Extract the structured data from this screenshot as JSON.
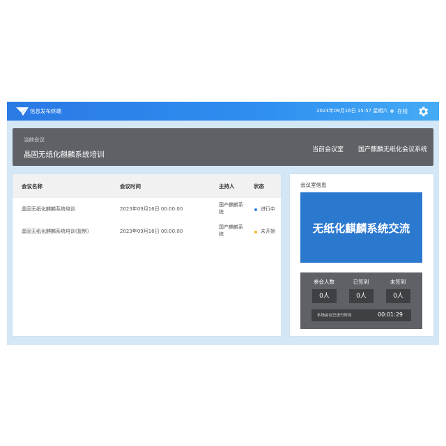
{
  "header": {
    "app_title": "信息发布终端",
    "datetime": "2023年09月16日 15:57 星期六",
    "status": "在线",
    "logo_icon": "paper-plane-logo",
    "settings_icon": "gear-icon",
    "colors": {
      "bar_start": "#2a79e4",
      "bar_end": "#45abf5"
    }
  },
  "banner": {
    "label": "当前会议",
    "meeting_name": "晶固无纸化麒麟系统培训",
    "room_label": "当前会议室",
    "room_name": "国产麒麟无纸化会议系统"
  },
  "table": {
    "headers": [
      "会议名称",
      "会议时间",
      "主持人",
      "状态"
    ],
    "rows": [
      {
        "name": "晶固无纸化麒麟系统培训",
        "time": "2023年09月16日 00:00:00",
        "host": "国产麒麟系统",
        "status": "进行中",
        "status_color": "#2f7fe8"
      },
      {
        "name": "晶固无纸化麒麟系统培训(复制)",
        "time": "2023年09月16日 00:00:00",
        "host": "国产麒麟系统",
        "status": "未开始",
        "status_color": "#f2b623"
      }
    ]
  },
  "room_info": {
    "title": "会议室信息",
    "display_text": "无纸化麒麟系统交流",
    "stats": {
      "attendees_label": "参会人数",
      "attendees_value": "0人",
      "signed_label": "已签到",
      "signed_value": "0人",
      "unsigned_label": "未签到",
      "unsigned_value": "0人",
      "elapsed_label": "本场会议已进行时间",
      "elapsed_value": "00:01:29"
    }
  }
}
